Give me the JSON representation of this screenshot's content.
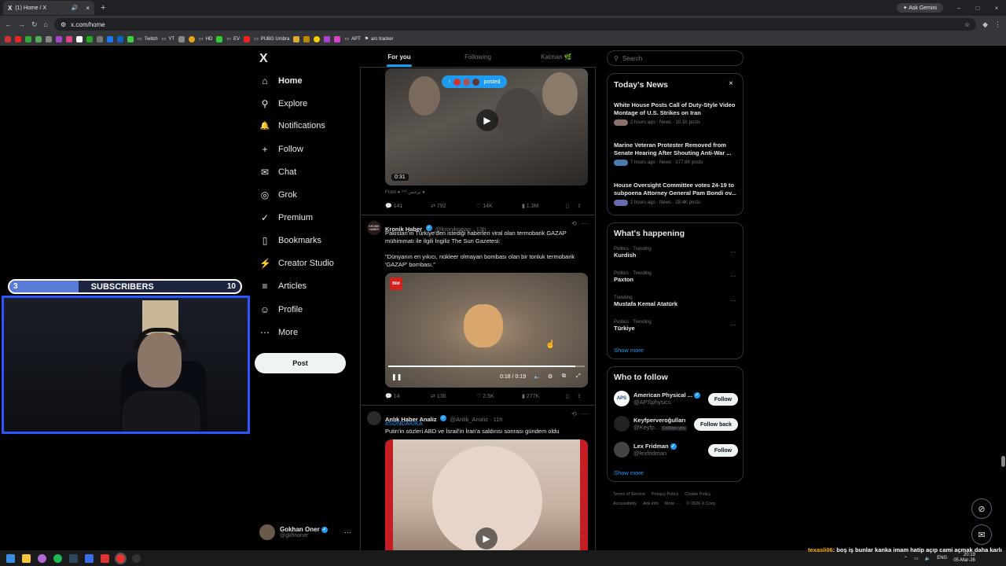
{
  "browser": {
    "tab_title": "(1) Home / X",
    "tab_close": "×",
    "new_tab": "+",
    "ask_gemini": "Ask Gemini",
    "url": "x.com/home",
    "window_controls": [
      "–",
      "□",
      "×"
    ],
    "nav_glyphs": [
      "←",
      "→",
      "↻",
      "⌂"
    ],
    "bookmarks": [
      {
        "label": "Twitch",
        "color": "#9146ff"
      },
      {
        "label": "YT",
        "color": "#888888"
      },
      {
        "label": "HD",
        "color": "#888888"
      },
      {
        "label": "EV",
        "color": "#888888"
      },
      {
        "label": "PUBG Umbra",
        "color": "#888888"
      },
      {
        "label": "APT",
        "color": "#888888"
      },
      {
        "label": "arc tracker",
        "color": "#888888"
      }
    ]
  },
  "sidebar": {
    "logo": "X",
    "items": [
      {
        "label": "Home",
        "icon": "⌂"
      },
      {
        "label": "Explore",
        "icon": "⚲"
      },
      {
        "label": "Notifications",
        "icon": "🔔"
      },
      {
        "label": "Follow",
        "icon": "+"
      },
      {
        "label": "Chat",
        "icon": "✉"
      },
      {
        "label": "Grok",
        "icon": "◎"
      },
      {
        "label": "Premium",
        "icon": "✓"
      },
      {
        "label": "Bookmarks",
        "icon": "▯"
      },
      {
        "label": "Creator Studio",
        "icon": "⚡"
      },
      {
        "label": "Articles",
        "icon": "≡"
      },
      {
        "label": "Profile",
        "icon": "☺"
      },
      {
        "label": "More",
        "icon": "⋯"
      }
    ],
    "post_button": "Post",
    "account": {
      "name": "Gokhan Oner",
      "handle": "@gkhnoner",
      "more": "···"
    }
  },
  "overlay": {
    "subs_current": "3",
    "subs_label": "SUBSCRIBERS",
    "subs_goal": "10",
    "subs_progress": 0.3
  },
  "timeline": {
    "tabs": [
      {
        "label": "For you",
        "active": true
      },
      {
        "label": "Following",
        "active": false
      },
      {
        "label": "Katman 🌿",
        "active": false
      }
    ],
    "posted_pill": "posted",
    "tweet1": {
      "duration": "0:31",
      "from": "From ● ²⁴³ ترجس ●",
      "actions": {
        "reply": "141",
        "retweet": "792",
        "like": "14K",
        "views": "1.3M"
      }
    },
    "tweet2": {
      "name": "Kronik Haber",
      "handle": "@kroniknews · 13h",
      "avatar_text": "KRONIK HABER",
      "text1": "Pakistan'ın Türkiye'den istediği haberleri viral olan termobarik GAZAP mühimmatı ile ilgili İngiliz The Sun Gazetesi:",
      "text2": "\"Dünyanın en yıkıcı, nükleer olmayan bombası olan bir tonluk termobarik 'GAZAP' bombası.\"",
      "media_badge": "Bild",
      "time": "0:18 / 0:19",
      "progress": 0.95,
      "actions": {
        "reply": "14",
        "retweet": "136",
        "like": "2.5K",
        "views": "277K"
      }
    },
    "tweet3": {
      "name": "Anlık Haber Analiz",
      "handle": "@Anlik_Analiz · 11h",
      "hashtag": "#SONDAKİKA",
      "text": "Putin'in sözleri ABD ve İsrail'in İran'a saldırısı sonrası gündem oldu"
    }
  },
  "right": {
    "search_placeholder": "Search",
    "news": {
      "title": "Today's News",
      "close": "×",
      "items": [
        {
          "headline": "White House Posts Call of Duty-Style Video Montage of U.S. Strikes on Iran",
          "meta": "2 hours ago · News · 10.1K posts"
        },
        {
          "headline": "Marine Veteran Protester Removed from Senate Hearing After Shouting Anti-War ...",
          "meta": "7 hours ago · News · 377.8K posts"
        },
        {
          "headline": "House Oversight Committee votes 24-19 to subpoena Attorney General Pam Bondi ov...",
          "meta": "2 hours ago · News · 28.4K posts"
        }
      ]
    },
    "happening": {
      "title": "What's happening",
      "items": [
        {
          "category": "Politics · Trending",
          "name": "Kurdish"
        },
        {
          "category": "Politics · Trending",
          "name": "Paxton"
        },
        {
          "category": "Trending",
          "name": "Mustafa Kemal Atatürk"
        },
        {
          "category": "Politics · Trending",
          "name": "Türkiye"
        }
      ],
      "show_more": "Show more"
    },
    "who_to_follow": {
      "title": "Who to follow",
      "items": [
        {
          "name": "American Physical ...",
          "handle": "@APSphysics",
          "button": "Follow",
          "avatar": "APS"
        },
        {
          "name": "Keyfperveroğulları",
          "handle": "@Keyfp...",
          "follows_you": "Follows you",
          "button": "Follow back",
          "avatar": ""
        },
        {
          "name": "Lex Fridman",
          "handle": "@lexfridman",
          "button": "Follow",
          "avatar": ""
        }
      ],
      "show_more": "Show more"
    },
    "footer": [
      "Terms of Service",
      "Privacy Policy",
      "Cookie Policy",
      "Accessibility",
      "Ads info",
      "More ···",
      "© 2026 X Corp."
    ]
  },
  "chat_overlay": {
    "user": "texasli06",
    "message": ": boş iş bunlar kanka imam hatip açıp cami açmak daha karlı"
  },
  "taskbar": {
    "lang": "ENG",
    "time": "20:19",
    "date": "05-Mar-26"
  }
}
